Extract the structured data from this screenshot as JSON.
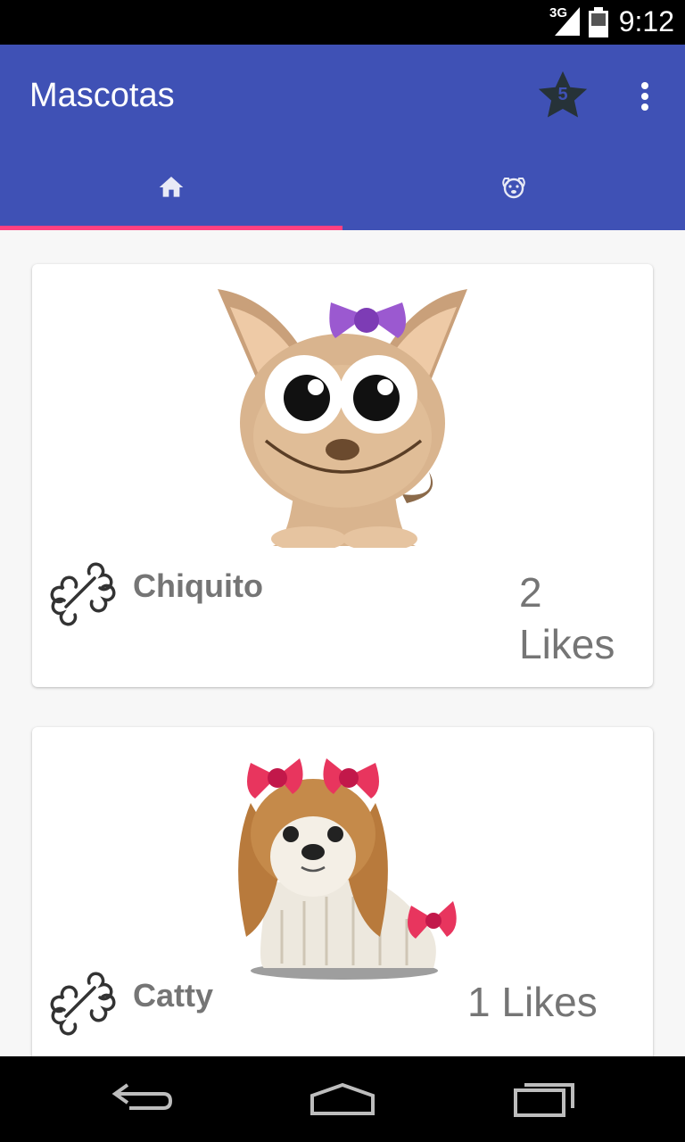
{
  "status_bar": {
    "network": "3G",
    "time": "9:12"
  },
  "app_bar": {
    "title": "Mascotas",
    "rating_badge": "5",
    "rating_icon": "star-icon",
    "menu_icon": "more-vert-icon"
  },
  "tabs": [
    {
      "icon": "home-icon",
      "selected": true
    },
    {
      "icon": "dog-face-icon",
      "selected": false
    }
  ],
  "colors": {
    "primary": "#3f51b5",
    "accent": "#ff4081",
    "text_secondary": "#757575"
  },
  "pets": [
    {
      "name": "Chiquito",
      "likes": "2 Likes",
      "image": "chihuahua-image",
      "action_icon": "bone-icon"
    },
    {
      "name": "Catty",
      "likes": "1 Likes",
      "image": "spaniel-image",
      "action_icon": "bone-icon"
    }
  ],
  "nav_bar": {
    "back": "back-icon",
    "home": "home-nav-icon",
    "recents": "recents-icon"
  }
}
